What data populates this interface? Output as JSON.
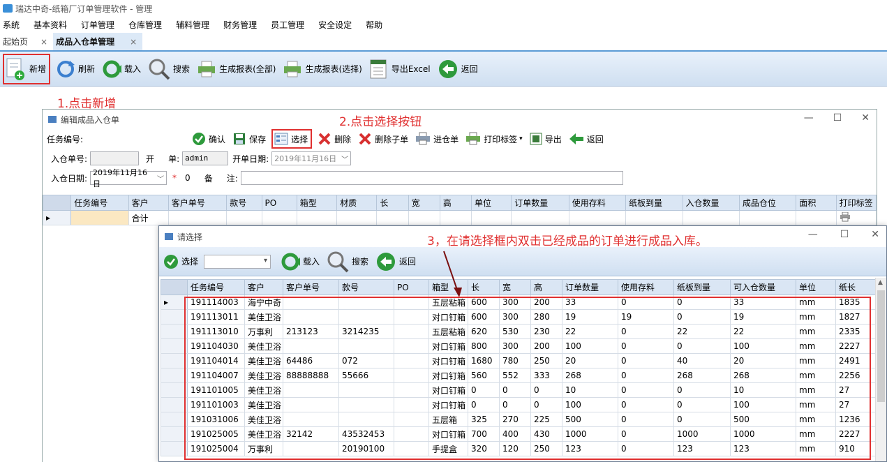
{
  "window": {
    "title": "瑞达中奇-纸箱厂订单管理软件 - 管理"
  },
  "menu": [
    "系统",
    "基本资料",
    "订单管理",
    "仓库管理",
    "辅料管理",
    "财务管理",
    "员工管理",
    "安全设定",
    "帮助"
  ],
  "doc_tabs": [
    {
      "label": "起始页",
      "close": "×"
    },
    {
      "label": "成品入仓单管理",
      "close": "×"
    }
  ],
  "main_toolbar": [
    "新增",
    "刷新",
    "载入",
    "搜索",
    "生成报表(全部)",
    "生成报表(选择)",
    "导出Excel",
    "返回"
  ],
  "annotations": {
    "step1": "1.点击新增",
    "step2": "2.点击选择按钮",
    "step3": "3，在请选择框内双击已经成品的订单进行成品入库。"
  },
  "edit_window": {
    "title": "编辑成品入仓单",
    "toolbar": {
      "task_label": "任务编号:",
      "buttons": [
        "确认",
        "保存",
        "选择",
        "删除",
        "删除子单",
        "进仓单",
        "打印标签",
        "导出",
        "返回"
      ]
    },
    "form": {
      "in_no_label": "入仓单号:",
      "maker_label1": "开",
      "maker_label2": "单:",
      "maker_value": "admin",
      "open_date_label": "开单日期:",
      "open_date_value": "2019年11月16日",
      "in_date_label": "入仓日期:",
      "in_date_value": "2019年11月16日",
      "required_mark": "*",
      "zero": "0",
      "remark_label1": "备",
      "remark_label2": "注:"
    },
    "grid": {
      "columns": [
        "任务编号",
        "客户",
        "客户单号",
        "款号",
        "PO",
        "箱型",
        "材质",
        "长",
        "宽",
        "高",
        "单位",
        "订单数量",
        "使用存料",
        "纸板到量",
        "入仓数量",
        "成品仓位",
        "面积",
        "打印标签"
      ],
      "total_label": "合计"
    }
  },
  "popup": {
    "title": "请选择",
    "toolbar": [
      "选择",
      "载入",
      "搜索",
      "返回"
    ],
    "columns": [
      "任务编号",
      "客户",
      "客户单号",
      "款号",
      "PO",
      "箱型",
      "长",
      "宽",
      "高",
      "订单数量",
      "使用存料",
      "纸板到量",
      "可入仓数量",
      "单位",
      "纸长"
    ],
    "rows": [
      [
        "191114003",
        "海宁中奇",
        "",
        "",
        "",
        "五层粘箱",
        "600",
        "300",
        "200",
        "33",
        "0",
        "0",
        "33",
        "mm",
        "1835"
      ],
      [
        "191113011",
        "美佳卫浴",
        "",
        "",
        "",
        "对口钉箱",
        "600",
        "300",
        "280",
        "19",
        "19",
        "0",
        "19",
        "mm",
        "1827"
      ],
      [
        "191113010",
        "万事利",
        "213123",
        "3214235",
        "",
        "五层粘箱",
        "620",
        "530",
        "230",
        "22",
        "0",
        "22",
        "22",
        "mm",
        "2335"
      ],
      [
        "191104030",
        "美佳卫浴",
        "",
        "",
        "",
        "对口钉箱",
        "800",
        "300",
        "200",
        "100",
        "0",
        "0",
        "100",
        "mm",
        "2227"
      ],
      [
        "191104014",
        "美佳卫浴",
        "64486",
        "072",
        "",
        "对口钉箱",
        "1680",
        "780",
        "250",
        "20",
        "0",
        "40",
        "20",
        "mm",
        "2491"
      ],
      [
        "191104007",
        "美佳卫浴",
        "88888888",
        "55666",
        "",
        "对口钉箱",
        "560",
        "552",
        "333",
        "268",
        "0",
        "268",
        "268",
        "mm",
        "2256"
      ],
      [
        "191101005",
        "美佳卫浴",
        "",
        "",
        "",
        "对口钉箱",
        "0",
        "0",
        "0",
        "10",
        "0",
        "0",
        "10",
        "mm",
        "27"
      ],
      [
        "191101003",
        "美佳卫浴",
        "",
        "",
        "",
        "对口钉箱",
        "0",
        "0",
        "0",
        "100",
        "0",
        "0",
        "100",
        "mm",
        "27"
      ],
      [
        "191031006",
        "美佳卫浴",
        "",
        "",
        "",
        "五层箱",
        "325",
        "270",
        "225",
        "500",
        "0",
        "0",
        "500",
        "mm",
        "1236"
      ],
      [
        "191025005",
        "美佳卫浴",
        "32142",
        "43532453",
        "",
        "对口钉箱",
        "700",
        "400",
        "430",
        "1000",
        "0",
        "1000",
        "1000",
        "mm",
        "2227"
      ],
      [
        "191025004",
        "万事利",
        "",
        "20190100",
        "",
        "手提盒",
        "320",
        "120",
        "250",
        "123",
        "0",
        "123",
        "123",
        "mm",
        "910"
      ]
    ]
  },
  "colors": {
    "annotation": "#e03030",
    "toolbar_bg": "#d6e4f4",
    "header_bg": "#dae6f4"
  }
}
